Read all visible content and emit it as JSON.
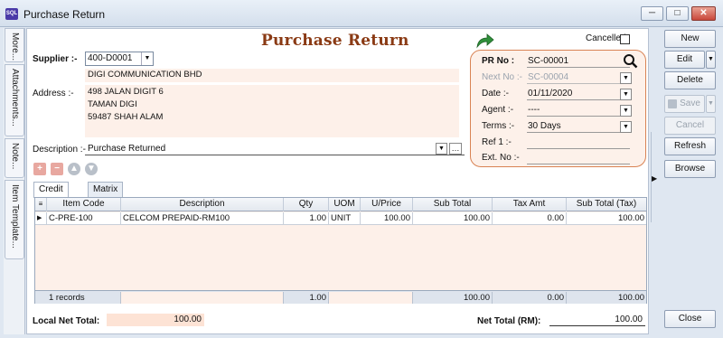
{
  "window": {
    "title": "Purchase Return",
    "app_icon_text": "SQL"
  },
  "side_tabs": [
    "More...",
    "Attachments...",
    "Note...",
    "Item Template..."
  ],
  "form": {
    "heading": "Purchase Return",
    "cancelled_label": "Cancelled",
    "cancelled": false,
    "supplier_label": "Supplier :-",
    "supplier_code": "400-D0001",
    "supplier_name": "DIGI COMMUNICATION BHD",
    "address_label": "Address :-",
    "address_lines": [
      "498 JALAN DIGIT 6",
      "TAMAN DIGI",
      "59487 SHAH ALAM"
    ],
    "description_label": "Description :-",
    "description_value": "Purchase Returned"
  },
  "pr_box": {
    "pr_no_label": "PR No :",
    "pr_no": "SC-00001",
    "next_no_label": "Next No :-",
    "next_no": "SC-00004",
    "date_label": "Date :-",
    "date": "01/11/2020",
    "agent_label": "Agent :-",
    "agent": "----",
    "terms_label": "Terms :-",
    "terms": "30 Days",
    "ref1_label": "Ref 1 :-",
    "ref1": "",
    "ext_no_label": "Ext. No :-",
    "ext_no": ""
  },
  "tabs": [
    "Credit Note",
    "Matrix"
  ],
  "grid": {
    "columns": [
      "Item Code",
      "Description",
      "Qty",
      "UOM",
      "U/Price",
      "Sub Total",
      "Tax Amt",
      "Sub Total (Tax)"
    ],
    "rows": [
      [
        "C-PRE-100",
        "CELCOM PREPAID-RM100",
        "1.00",
        "UNIT",
        "100.00",
        "100.00",
        "0.00",
        "100.00"
      ]
    ],
    "footer": {
      "records": "1 records",
      "qty": "1.00",
      "sub_total": "100.00",
      "tax_amt": "0.00",
      "sub_total_tax": "100.00"
    }
  },
  "totals": {
    "local_net_total_label": "Local Net Total:",
    "local_net_total": "100.00",
    "net_total_label": "Net Total (RM):",
    "net_total": "100.00"
  },
  "buttons": {
    "new": "New",
    "edit": "Edit",
    "delete": "Delete",
    "save": "Save",
    "cancel": "Cancel",
    "refresh": "Refresh",
    "browse": "Browse",
    "close": "Close"
  }
}
